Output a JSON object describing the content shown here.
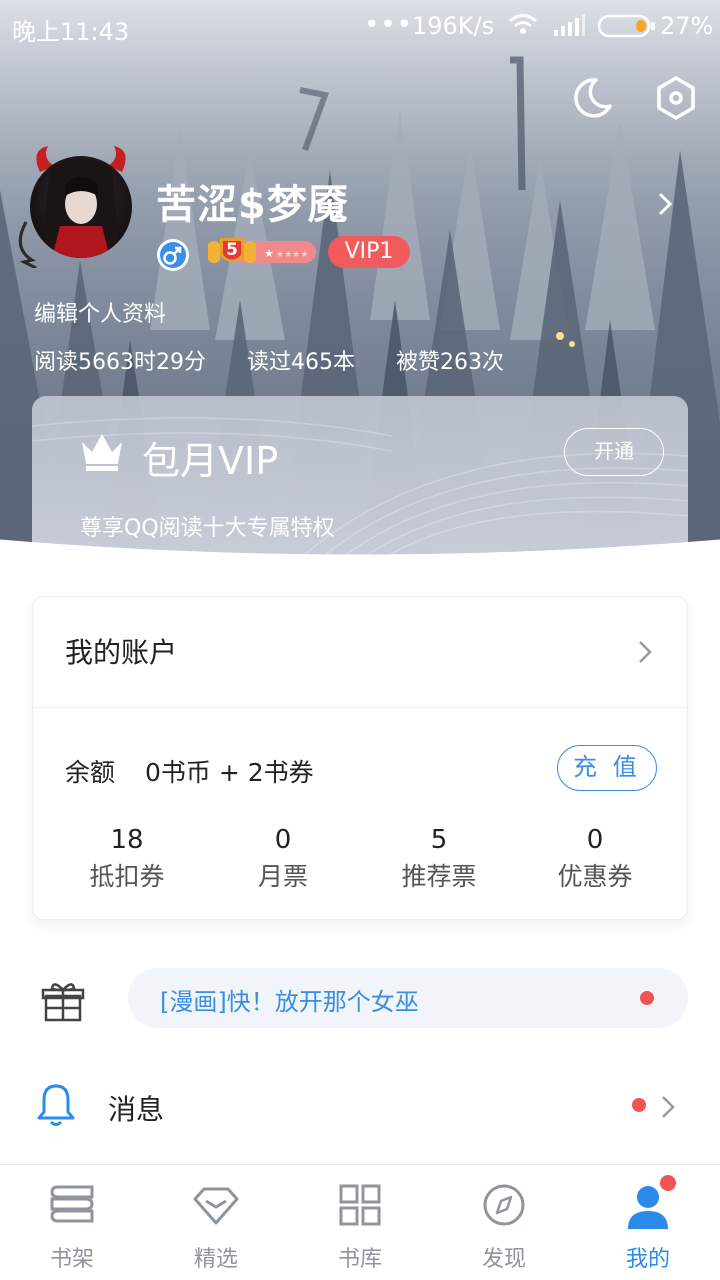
{
  "status_bar": {
    "time": "晚上11:43",
    "dots": "•••",
    "speed": "196K/s",
    "battery_pct": "27%"
  },
  "profile": {
    "username": "苦涩$梦魇",
    "vip_badge": "VIP1",
    "level": "5",
    "edit_label": "编辑个人资料",
    "stats": {
      "reading_time": "阅读5663时29分",
      "books_read": "读过465本",
      "likes": "被赞263次"
    }
  },
  "vip_card": {
    "title": "包月VIP",
    "subtitle": "尊享QQ阅读十大专属特权",
    "button": "开通"
  },
  "account": {
    "title": "我的账户",
    "balance_label": "余额",
    "balance_value": "0书币 + 2书券",
    "recharge_button": "充 值",
    "metrics": [
      {
        "value": "18",
        "label": "抵扣券"
      },
      {
        "value": "0",
        "label": "月票"
      },
      {
        "value": "5",
        "label": "推荐票"
      },
      {
        "value": "0",
        "label": "优惠券"
      }
    ]
  },
  "promo": {
    "text": "[漫画]快！放开那个女巫"
  },
  "messages": {
    "label": "消息"
  },
  "tabs": [
    {
      "label": "书架",
      "icon": "bookshelf-icon"
    },
    {
      "label": "精选",
      "icon": "diamond-icon"
    },
    {
      "label": "书库",
      "icon": "grid-icon"
    },
    {
      "label": "发现",
      "icon": "compass-icon"
    },
    {
      "label": "我的",
      "icon": "person-icon"
    }
  ],
  "colors": {
    "accent": "#2a8bea",
    "vip_red": "#f25b5b",
    "notification_dot": "#f25353"
  }
}
